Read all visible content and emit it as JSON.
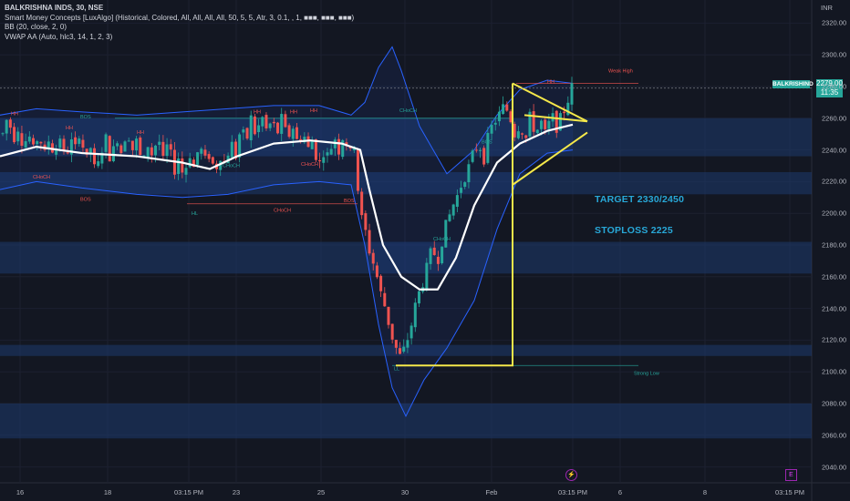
{
  "legend": {
    "title": "BALKRISHNA INDS, 30, NSE",
    "indicators": [
      "Smart Money Concepts [LuxAlgo] (Historical, Colored, All, All, All, All, 50, 5, 5, Atr, 3, 0.1, , 1, ■■■, ■■■, ■■■)",
      "BB (20, close, 2, 0)",
      "VWAP AA (Auto, hlc3, 14, 1, 2, 3)"
    ]
  },
  "annotations": {
    "target": "TARGET 2330/2450",
    "stoploss": "STOPLOSS 2225"
  },
  "price_axis": {
    "currency": "INR",
    "symbol_tag": "BALKRISHIND",
    "last_price": "2279.00",
    "countdown": "11:35"
  },
  "time_axis_labels": [
    "16",
    "18",
    "03:15 PM",
    "23",
    "25",
    "30",
    "Feb",
    "03:15 PM",
    "6",
    "8",
    "03:15 PM"
  ],
  "event_icons": {
    "dividend": "⚡",
    "earnings": "E"
  },
  "colors": {
    "background": "#131722",
    "up": "#26a69a",
    "down": "#ef5350",
    "bb_band": "#2962ff",
    "bb_basis": "#ffffff",
    "triangle": "#f5e84a",
    "zone": "#1e3a6e",
    "annotation": "#28a8d8"
  },
  "chart_data": {
    "type": "candlestick",
    "title": "BALKRISHNA INDS, 30, NSE",
    "ylim": [
      2030,
      2330
    ],
    "y_ticks": [
      2040,
      2060,
      2080,
      2100,
      2120,
      2140,
      2160,
      2180,
      2200,
      2220,
      2240,
      2260,
      2280,
      2300,
      2320
    ],
    "grid": true,
    "last_price": 2279.0,
    "path_prices": [
      2250,
      2262,
      2247,
      2255,
      2243,
      2250,
      2238,
      2252,
      2235,
      2248,
      2236,
      2250,
      2233,
      2246,
      2240,
      2255,
      2230,
      2242,
      2222,
      2240,
      2247,
      2232,
      2250,
      2238,
      2255,
      2240,
      2246,
      2228,
      2244,
      2236,
      2250,
      2232,
      2245,
      2226,
      2236,
      2222,
      2240,
      2228,
      2244,
      2232,
      2238,
      2226,
      2238,
      2230,
      2246,
      2236,
      2254,
      2244,
      2260,
      2248,
      2262,
      2252,
      2258,
      2250,
      2260,
      2246,
      2256,
      2244,
      2252,
      2240,
      2248,
      2228,
      2240,
      2235,
      2250,
      2240,
      2252,
      2235,
      2246,
      2200,
      2190,
      2175,
      2165,
      2150,
      2140,
      2125,
      2115,
      2108,
      2118,
      2130,
      2145,
      2155,
      2165,
      2178,
      2170,
      2185,
      2195,
      2205,
      2212,
      2222,
      2228,
      2238,
      2245,
      2235,
      2250,
      2258,
      2262,
      2268,
      2262,
      2250,
      2258,
      2245,
      2262,
      2250,
      2258,
      2248,
      2262,
      2255,
      2260,
      2270,
      2279
    ],
    "bb_upper": [
      [
        0,
        2262
      ],
      [
        40,
        2266
      ],
      [
        90,
        2264
      ],
      [
        150,
        2262
      ],
      [
        200,
        2264
      ],
      [
        250,
        2266
      ],
      [
        300,
        2268
      ],
      [
        350,
        2268
      ],
      [
        385,
        2262
      ],
      [
        400,
        2270
      ],
      [
        415,
        2292
      ],
      [
        430,
        2305
      ],
      [
        440,
        2290
      ],
      [
        460,
        2255
      ],
      [
        490,
        2225
      ],
      [
        520,
        2240
      ],
      [
        545,
        2262
      ],
      [
        570,
        2278
      ],
      [
        600,
        2284
      ],
      [
        628,
        2282
      ]
    ],
    "bb_lower": [
      [
        0,
        2215
      ],
      [
        40,
        2220
      ],
      [
        90,
        2216
      ],
      [
        150,
        2212
      ],
      [
        200,
        2210
      ],
      [
        250,
        2212
      ],
      [
        300,
        2218
      ],
      [
        350,
        2220
      ],
      [
        385,
        2218
      ],
      [
        400,
        2180
      ],
      [
        415,
        2130
      ],
      [
        430,
        2090
      ],
      [
        445,
        2072
      ],
      [
        465,
        2095
      ],
      [
        490,
        2115
      ],
      [
        520,
        2145
      ],
      [
        545,
        2190
      ],
      [
        570,
        2225
      ],
      [
        600,
        2238
      ],
      [
        628,
        2240
      ]
    ],
    "bb_basis": [
      [
        0,
        2236
      ],
      [
        40,
        2242
      ],
      [
        90,
        2238
      ],
      [
        150,
        2236
      ],
      [
        200,
        2232
      ],
      [
        230,
        2228
      ],
      [
        260,
        2236
      ],
      [
        300,
        2244
      ],
      [
        340,
        2246
      ],
      [
        375,
        2244
      ],
      [
        395,
        2240
      ],
      [
        405,
        2215
      ],
      [
        420,
        2180
      ],
      [
        440,
        2160
      ],
      [
        460,
        2152
      ],
      [
        480,
        2152
      ],
      [
        500,
        2172
      ],
      [
        520,
        2205
      ],
      [
        545,
        2232
      ],
      [
        570,
        2244
      ],
      [
        600,
        2252
      ],
      [
        628,
        2256
      ]
    ],
    "zones": [
      [
        2236,
        2260
      ],
      [
        2212,
        2226
      ],
      [
        2162,
        2182
      ],
      [
        2110,
        2117
      ],
      [
        2058,
        2080
      ]
    ],
    "triangle_pattern": [
      [
        562,
        2282
      ],
      [
        562,
        2104
      ],
      [
        434,
        2104
      ],
      [
        644,
        2258
      ],
      [
        616,
        2250
      ],
      [
        562,
        2218
      ]
    ],
    "smc_labels": [
      {
        "x": 12,
        "y": 2262,
        "text": "HH",
        "color": "#ef5350"
      },
      {
        "x": 88,
        "y": 2260,
        "text": "BOS",
        "color": "#26a69a"
      },
      {
        "x": 72,
        "y": 2253,
        "text": "HH",
        "color": "#ef5350"
      },
      {
        "x": 150,
        "y": 2250,
        "text": "HH",
        "color": "#ef5350"
      },
      {
        "x": 340,
        "y": 2264,
        "text": "HH",
        "color": "#ef5350"
      },
      {
        "x": 278,
        "y": 2263,
        "text": "HH",
        "color": "#ef5350"
      },
      {
        "x": 318,
        "y": 2263,
        "text": "HH",
        "color": "#ef5350"
      },
      {
        "x": 438,
        "y": 2264,
        "text": "CHoCH",
        "color": "#26a69a"
      },
      {
        "x": 300,
        "y": 2201,
        "text": "CHoCH",
        "color": "#ef5350"
      },
      {
        "x": 210,
        "y": 2199,
        "text": "HL",
        "color": "#26a69a"
      },
      {
        "x": 432,
        "y": 2101,
        "text": "LL",
        "color": "#26a69a"
      },
      {
        "x": 667,
        "y": 2289,
        "text": "Weak High",
        "color": "#ef5350"
      },
      {
        "x": 695,
        "y": 2098,
        "text": "Strong Low",
        "color": "#26a69a"
      },
      {
        "x": 600,
        "y": 2282,
        "text": "HH",
        "color": "#ef5350"
      },
      {
        "x": 36,
        "y": 2222,
        "text": "CHoCH",
        "color": "#ef5350"
      },
      {
        "x": 244,
        "y": 2229,
        "text": "CHoCH",
        "color": "#26a69a"
      },
      {
        "x": 330,
        "y": 2230,
        "text": "CHoCH",
        "color": "#ef5350"
      },
      {
        "x": 377,
        "y": 2207,
        "text": "BOS",
        "color": "#ef5350"
      },
      {
        "x": 475,
        "y": 2183,
        "text": "CHoCH",
        "color": "#26a69a"
      },
      {
        "x": 528,
        "y": 2244,
        "text": "BOS",
        "color": "#26a69a"
      },
      {
        "x": 88,
        "y": 2208,
        "text": "BOS",
        "color": "#ef5350"
      }
    ],
    "level_lines": [
      {
        "y": 2260,
        "x1": 126,
        "x2": 560,
        "color": "#26a69a"
      },
      {
        "y": 2206,
        "x1": 205,
        "x2": 392,
        "color": "#ef5350"
      },
      {
        "y": 2282,
        "x1": 566,
        "x2": 700,
        "color": "#ef5350"
      },
      {
        "y": 2104,
        "x1": 430,
        "x2": 700,
        "color": "#26a69a"
      }
    ]
  }
}
